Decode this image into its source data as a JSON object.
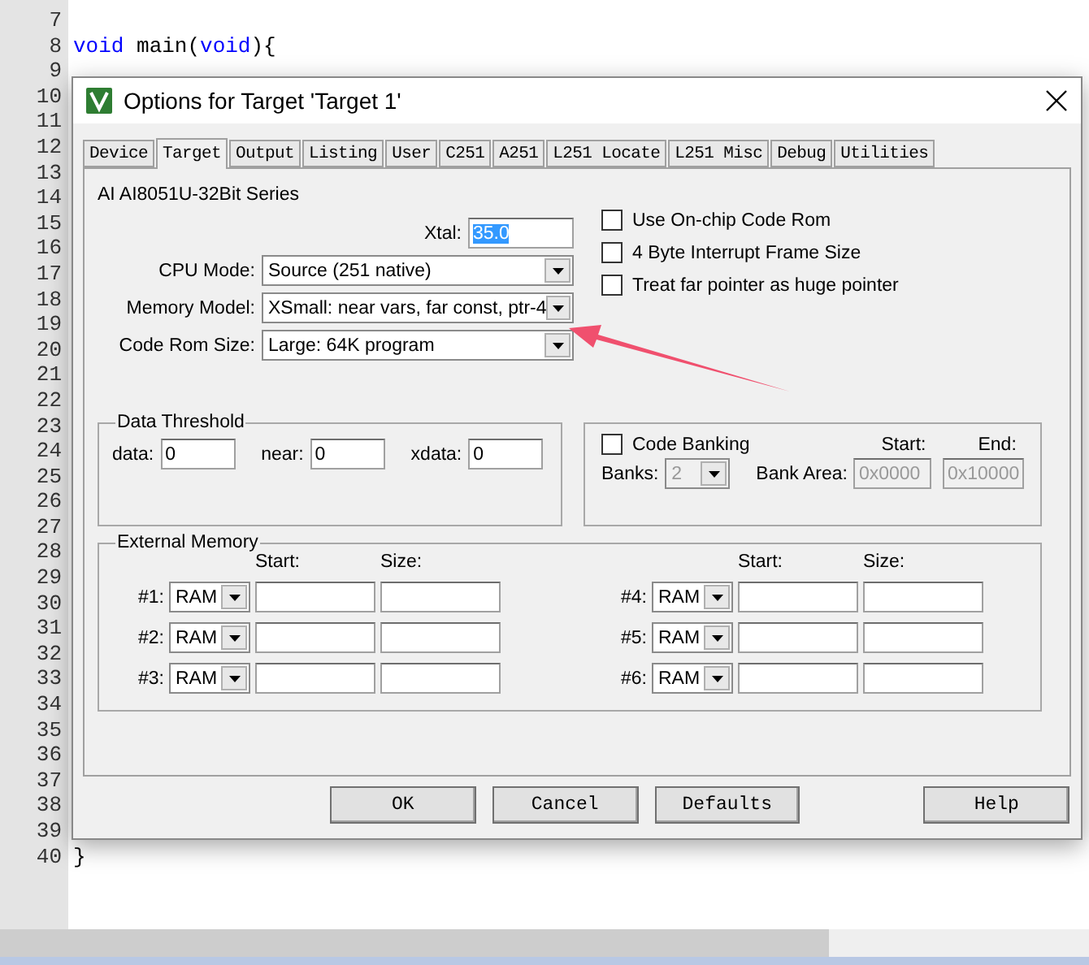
{
  "editor": {
    "lines": [
      {
        "number": "7"
      },
      {
        "number": "8",
        "code": [
          {
            "text": "void",
            "kind": "keyword"
          },
          {
            "text": " main(",
            "kind": "plain"
          },
          {
            "text": "void",
            "kind": "keyword"
          },
          {
            "text": "){",
            "kind": "plain"
          }
        ]
      },
      {
        "number": "9"
      },
      {
        "number": "10"
      },
      {
        "number": "11"
      },
      {
        "number": "12"
      },
      {
        "number": "13"
      },
      {
        "number": "14"
      },
      {
        "number": "15"
      },
      {
        "number": "16"
      },
      {
        "number": "17"
      },
      {
        "number": "18"
      },
      {
        "number": "19"
      },
      {
        "number": "20"
      },
      {
        "number": "21"
      },
      {
        "number": "22"
      },
      {
        "number": "23"
      },
      {
        "number": "24"
      },
      {
        "number": "25"
      },
      {
        "number": "26"
      },
      {
        "number": "27"
      },
      {
        "number": "28"
      },
      {
        "number": "29"
      },
      {
        "number": "30"
      },
      {
        "number": "31"
      },
      {
        "number": "32"
      },
      {
        "number": "33"
      },
      {
        "number": "34"
      },
      {
        "number": "35"
      },
      {
        "number": "36"
      },
      {
        "number": "37"
      },
      {
        "number": "38"
      },
      {
        "number": "39"
      },
      {
        "number": "40",
        "code": [
          {
            "text": "}",
            "kind": "plain"
          }
        ]
      }
    ]
  },
  "dialog": {
    "title": "Options for Target 'Target 1'",
    "tabs": [
      {
        "label": "Device",
        "selected": false
      },
      {
        "label": "Target",
        "selected": true
      },
      {
        "label": "Output",
        "selected": false
      },
      {
        "label": "Listing",
        "selected": false
      },
      {
        "label": "User",
        "selected": false
      },
      {
        "label": "C251",
        "selected": false
      },
      {
        "label": "A251",
        "selected": false
      },
      {
        "label": "L251 Locate",
        "selected": false
      },
      {
        "label": "L251 Misc",
        "selected": false
      },
      {
        "label": "Debug",
        "selected": false
      },
      {
        "label": "Utilities",
        "selected": false
      }
    ],
    "device": "AI AI8051U-32Bit Series",
    "xtal": {
      "label": "Xtal:",
      "value": "35.0",
      "selected": true
    },
    "dropdowns": [
      {
        "label": "CPU Mode:",
        "value": "Source (251 native)"
      },
      {
        "label": "Memory Model:",
        "value": "XSmall: near vars, far const, ptr-4"
      },
      {
        "label": "Code Rom Size:",
        "value": "Large: 64K program"
      }
    ],
    "options": [
      {
        "label": "Use On-chip Code Rom",
        "checked": false
      },
      {
        "label": "4 Byte Interrupt Frame Size",
        "checked": false
      },
      {
        "label": "Treat far pointer as huge pointer",
        "checked": false
      }
    ],
    "data_threshold": {
      "title": "Data Threshold",
      "fields": [
        {
          "label": "data:",
          "value": "0"
        },
        {
          "label": "near:",
          "value": "0"
        },
        {
          "label": "xdata:",
          "value": "0"
        }
      ]
    },
    "code_banking": {
      "label": "Code Banking",
      "checked": false,
      "disabled": true,
      "banks_label": "Banks:",
      "banks_value": "2",
      "start_label": "Start:",
      "end_label": "End:",
      "bank_area_label": "Bank Area:",
      "start_value": "0x0000",
      "end_value": "0x10000"
    },
    "external_memory": {
      "title": "External Memory",
      "columns": [
        {
          "start_header": "Start:",
          "size_header": "Size:",
          "rows": [
            {
              "label": "#1:",
              "type": "RAM"
            },
            {
              "label": "#2:",
              "type": "RAM"
            },
            {
              "label": "#3:",
              "type": "RAM"
            }
          ]
        },
        {
          "start_header": "Start:",
          "size_header": "Size:",
          "rows": [
            {
              "label": "#4:",
              "type": "RAM"
            },
            {
              "label": "#5:",
              "type": "RAM"
            },
            {
              "label": "#6:",
              "type": "RAM"
            }
          ]
        }
      ]
    },
    "buttons": [
      {
        "label": "OK",
        "kind": "main"
      },
      {
        "label": "Cancel",
        "kind": "main"
      },
      {
        "label": "Defaults",
        "kind": "main"
      },
      {
        "label": "Help",
        "kind": "help"
      }
    ]
  }
}
